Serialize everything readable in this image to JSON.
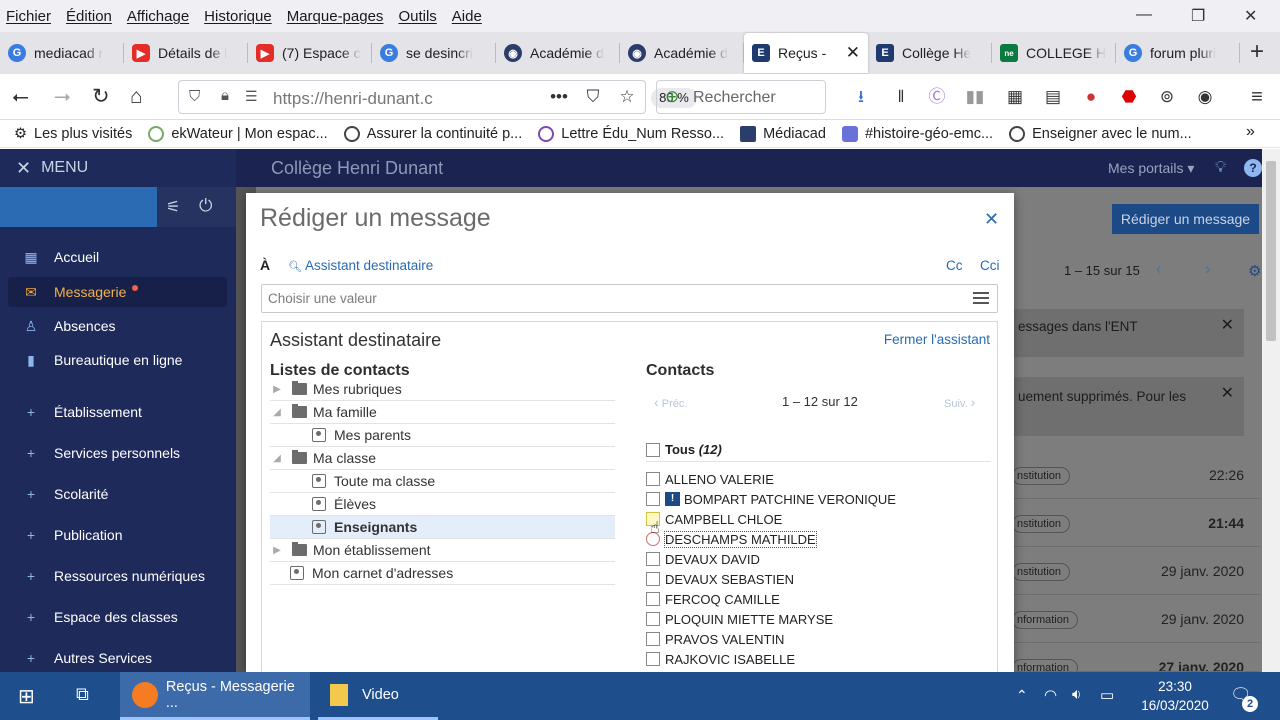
{
  "menubar": {
    "items": [
      "Fichier",
      "Édition",
      "Affichage",
      "Historique",
      "Marque-pages",
      "Outils",
      "Aide"
    ]
  },
  "tabs": [
    {
      "label": "mediacad r",
      "color": "#3a7ce0",
      "glyph": "G"
    },
    {
      "label": "Détails de l",
      "color": "#e52d27",
      "glyph": "▶"
    },
    {
      "label": "(7) Espace c",
      "color": "#e52d27",
      "glyph": "▶"
    },
    {
      "label": "se desincri",
      "color": "#3a7ce0",
      "glyph": "G"
    },
    {
      "label": "Académie d",
      "color": "#2b3d6b",
      "glyph": "◉"
    },
    {
      "label": "Académie d",
      "color": "#2b3d6b",
      "glyph": "◉"
    },
    {
      "label": "Reçus -",
      "color": "#1e3a6e",
      "glyph": "E",
      "active": true
    },
    {
      "label": "Collège He",
      "color": "#1e3a6e",
      "glyph": "E"
    },
    {
      "label": "COLLEGE H",
      "color": "#0a7a3e",
      "glyph": "ne"
    },
    {
      "label": "forum pluri",
      "color": "#3a7ce0",
      "glyph": "G"
    }
  ],
  "nav": {
    "url": "https://henri-dunant.c",
    "zoom": "80 %",
    "search_placeholder": "Rechercher"
  },
  "bookmarks": [
    "Les plus visités",
    "ekWateur | Mon espac...",
    "Assurer la continuité p...",
    "Lettre Édu_Num Resso...",
    "Médiacad",
    "#histoire-géo-emc...",
    "Enseigner avec le num..."
  ],
  "ent": {
    "menu_label": "MENU",
    "title": "Collège Henri Dunant",
    "portals": "Mes portails"
  },
  "sidebar": {
    "items": [
      {
        "label": "Accueil",
        "icon": "grid-icon"
      },
      {
        "label": "Messagerie",
        "icon": "mail-icon",
        "active": true
      },
      {
        "label": "Absences",
        "icon": "person-icon"
      },
      {
        "label": "Bureautique en ligne",
        "icon": "office-icon"
      },
      {
        "label": "Établissement",
        "icon": "plus-icon"
      },
      {
        "label": "Services personnels",
        "icon": "plus-icon"
      },
      {
        "label": "Scolarité",
        "icon": "plus-icon"
      },
      {
        "label": "Publication",
        "icon": "plus-icon"
      },
      {
        "label": "Ressources numériques",
        "icon": "plus-icon"
      },
      {
        "label": "Espace des classes",
        "icon": "plus-icon"
      },
      {
        "label": "Autres Services",
        "icon": "plus-icon"
      }
    ]
  },
  "background": {
    "compose_button": "Rédiger un message",
    "pagination": "1 – 15 sur 15",
    "alerts": [
      "essages dans l'ENT",
      "uement supprimés. Pour les"
    ],
    "rows": [
      {
        "tag": "nstitution",
        "time": "22:26",
        "bold": false
      },
      {
        "tag": "nstitution",
        "time": "21:44",
        "bold": true
      },
      {
        "tag": "nstitution",
        "time": "29 janv. 2020",
        "bold": false
      },
      {
        "tag": "nformation",
        "time": "29 janv. 2020",
        "bold": false
      },
      {
        "tag": "nformation",
        "time": "27 janv. 2020",
        "bold": true
      }
    ]
  },
  "modal": {
    "title": "Rédiger un message",
    "to_label": "À",
    "assistant_link": "Assistant destinataire",
    "cc": "Cc",
    "cci": "Cci",
    "choose_placeholder": "Choisir une valeur",
    "assistant_title": "Assistant destinataire",
    "close_assistant": "Fermer l'assistant",
    "lists_heading": "Listes de contacts",
    "tree": [
      {
        "label": "Mes rubriques",
        "type": "folder",
        "twisty": "▶",
        "level": 0
      },
      {
        "label": "Ma famille",
        "type": "folder",
        "twisty": "◢",
        "level": 0
      },
      {
        "label": "Mes parents",
        "type": "book",
        "twisty": "",
        "level": 1
      },
      {
        "label": "Ma classe",
        "type": "folder",
        "twisty": "◢",
        "level": 0
      },
      {
        "label": "Toute ma classe",
        "type": "book",
        "twisty": "",
        "level": 1
      },
      {
        "label": "Élèves",
        "type": "book",
        "twisty": "",
        "level": 1
      },
      {
        "label": "Enseignants",
        "type": "book",
        "twisty": "",
        "level": 1,
        "selected": true
      },
      {
        "label": "Mon établissement",
        "type": "folder",
        "twisty": "▶",
        "level": 0
      },
      {
        "label": "Mon carnet d'adresses",
        "type": "book",
        "twisty": "",
        "level": 0
      }
    ],
    "contacts_heading": "Contacts",
    "prev": "Préc.",
    "next": "Suiv.",
    "pager": "1 – 12 sur 12",
    "all_label": "Tous",
    "all_count": "(12)",
    "contacts": [
      "ALLENO VALERIE",
      "BOMPART PATCHINE VERONIQUE",
      "CAMPBELL CHLOE",
      "DESCHAMPS MATHILDE",
      "DEVAUX DAVID",
      "DEVAUX SEBASTIEN",
      "FERCOQ CAMILLE",
      "PLOQUIN MIETTE MARYSE",
      "PRAVOS VALENTIN",
      "RAJKOVIC ISABELLE"
    ]
  },
  "taskbar": {
    "firefox": "Reçus - Messagerie ...",
    "video": "Video",
    "time": "23:30",
    "date": "16/03/2020",
    "notifications": "2"
  }
}
